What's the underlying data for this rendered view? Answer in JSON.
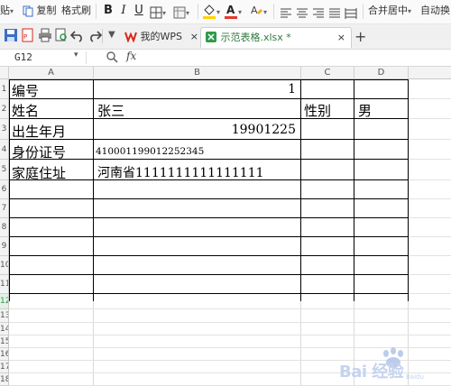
{
  "toolbar": {
    "paste_label": "贴",
    "copy_label": "复制",
    "format_painter_label": "格式刷",
    "bold_label": "B",
    "italic_label": "I",
    "underline_label": "U",
    "merge_center_label": "合并居中",
    "auto_wrap_label": "自动换"
  },
  "tabs": {
    "home_tab_label": "我的WPS",
    "file_tab_label": "示范表格.xlsx *",
    "close_glyph": "×",
    "new_tab_glyph": "+"
  },
  "formula_bar": {
    "cell_ref": "G12",
    "fx_label": "fx",
    "formula_value": ""
  },
  "columns": [
    "A",
    "B",
    "C",
    "D"
  ],
  "row_labels": [
    "1",
    "2",
    "3",
    "4",
    "5",
    "6",
    "7",
    "8",
    "9",
    "10",
    "11",
    "12",
    "13",
    "14",
    "15",
    "16",
    "17",
    "18"
  ],
  "sheet": {
    "r1_label": "编号",
    "r1_value": "1",
    "r2_label": "姓名",
    "r2_value": "张三",
    "r2_c_label": "性别",
    "r2_d_value": "男",
    "r3_label": "出生年月",
    "r3_value": "19901225",
    "r4_label": "身份证号",
    "r4_value": "410001199012252345",
    "r5_label": "家庭住址",
    "r5_value": "河南省1111111111111111"
  },
  "watermark": {
    "text": "Bai 经验",
    "brand": "Baidu"
  },
  "colors": {
    "accent_green": "#2f9a4a",
    "font_color_red": "#e23b2e",
    "highlight_yellow": "#ffd200",
    "wps_red": "#d9251c"
  }
}
